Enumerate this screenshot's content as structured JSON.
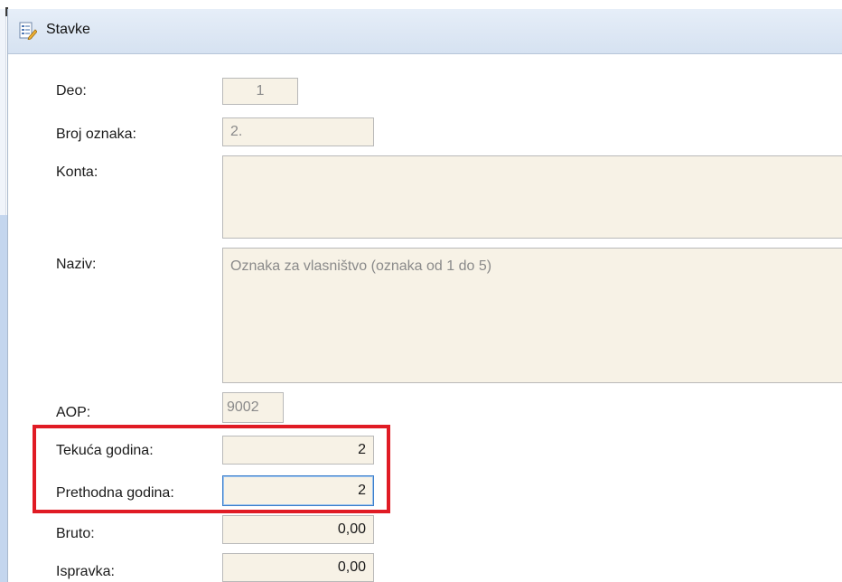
{
  "window": {
    "title": "Stavke",
    "title_icon": "form-edit-icon"
  },
  "form": {
    "deo": {
      "label": "Deo:",
      "value": "1"
    },
    "broj_oznaka": {
      "label": "Broj oznaka:",
      "value": "2."
    },
    "konta": {
      "label": "Konta:",
      "value": ""
    },
    "naziv": {
      "label": "Naziv:",
      "value": "Oznaka za vlasništvo (oznaka od 1 do 5)"
    },
    "aop": {
      "label": "AOP:",
      "value": "9002"
    },
    "tekuca_godina": {
      "label": "Tekuća godina:",
      "value": "2"
    },
    "prethodna_godina": {
      "label": "Prethodna godina:",
      "value": "2"
    },
    "bruto": {
      "label": "Bruto:",
      "value": "0,00"
    },
    "ispravka": {
      "label": "Ispravka:",
      "value": "0,00"
    }
  },
  "colors": {
    "field_bg": "#f7f2e6",
    "highlight": "#e01b24",
    "focus_border": "#3b7ecb"
  }
}
